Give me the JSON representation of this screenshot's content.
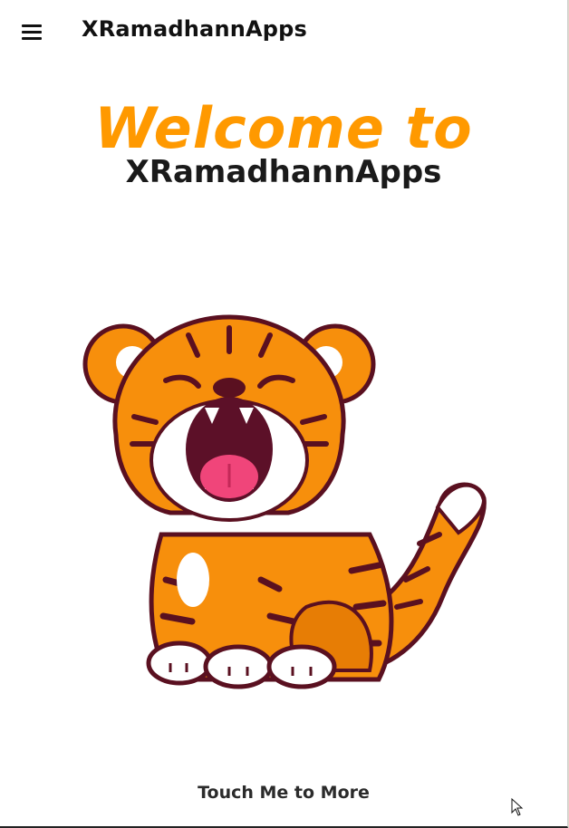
{
  "appbar": {
    "title": "XRamadhannApps",
    "menu_icon": "hamburger-menu-icon"
  },
  "hero": {
    "headline": "Welcome to",
    "subheadline": "XRamadhannApps"
  },
  "illustration": {
    "name": "roaring-tiger-illustration"
  },
  "cta": {
    "label": "Touch Me to More"
  },
  "colors": {
    "accent": "#ff9900",
    "text": "#1a1a1a",
    "tiger_orange": "#f78f0c",
    "tiger_outline": "#5a1020"
  }
}
